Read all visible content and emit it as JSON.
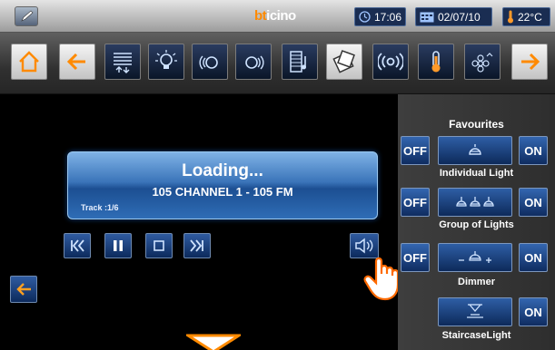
{
  "status": {
    "brand_left": "bt",
    "brand_right": "icino",
    "time": "17:06",
    "date": "02/07/10",
    "temperature": "22°C"
  },
  "toolbar": {
    "icons": [
      "home-icon",
      "back-arrow-icon",
      "shutters-icon",
      "light-bulb-icon",
      "lighting-scene-icon",
      "lighting-group-icon",
      "music-icon",
      "scenarios-icon",
      "radio-waves-icon",
      "thermometer-icon",
      "garden-light-icon",
      "forward-arrow-icon"
    ]
  },
  "player": {
    "status": "Loading...",
    "station": "105 CHANNEL 1 - 105 FM",
    "track": "Track :1/6"
  },
  "favourites": {
    "title": "Favourites",
    "off_label": "OFF",
    "on_label": "ON",
    "items": [
      {
        "label": "Individual Light"
      },
      {
        "label": "Group of Lights"
      },
      {
        "label": "Dimmer"
      },
      {
        "label": "StaircaseLight"
      }
    ]
  },
  "colors": {
    "accent": "#ff8a00",
    "button_blue": "#1c4f92"
  }
}
